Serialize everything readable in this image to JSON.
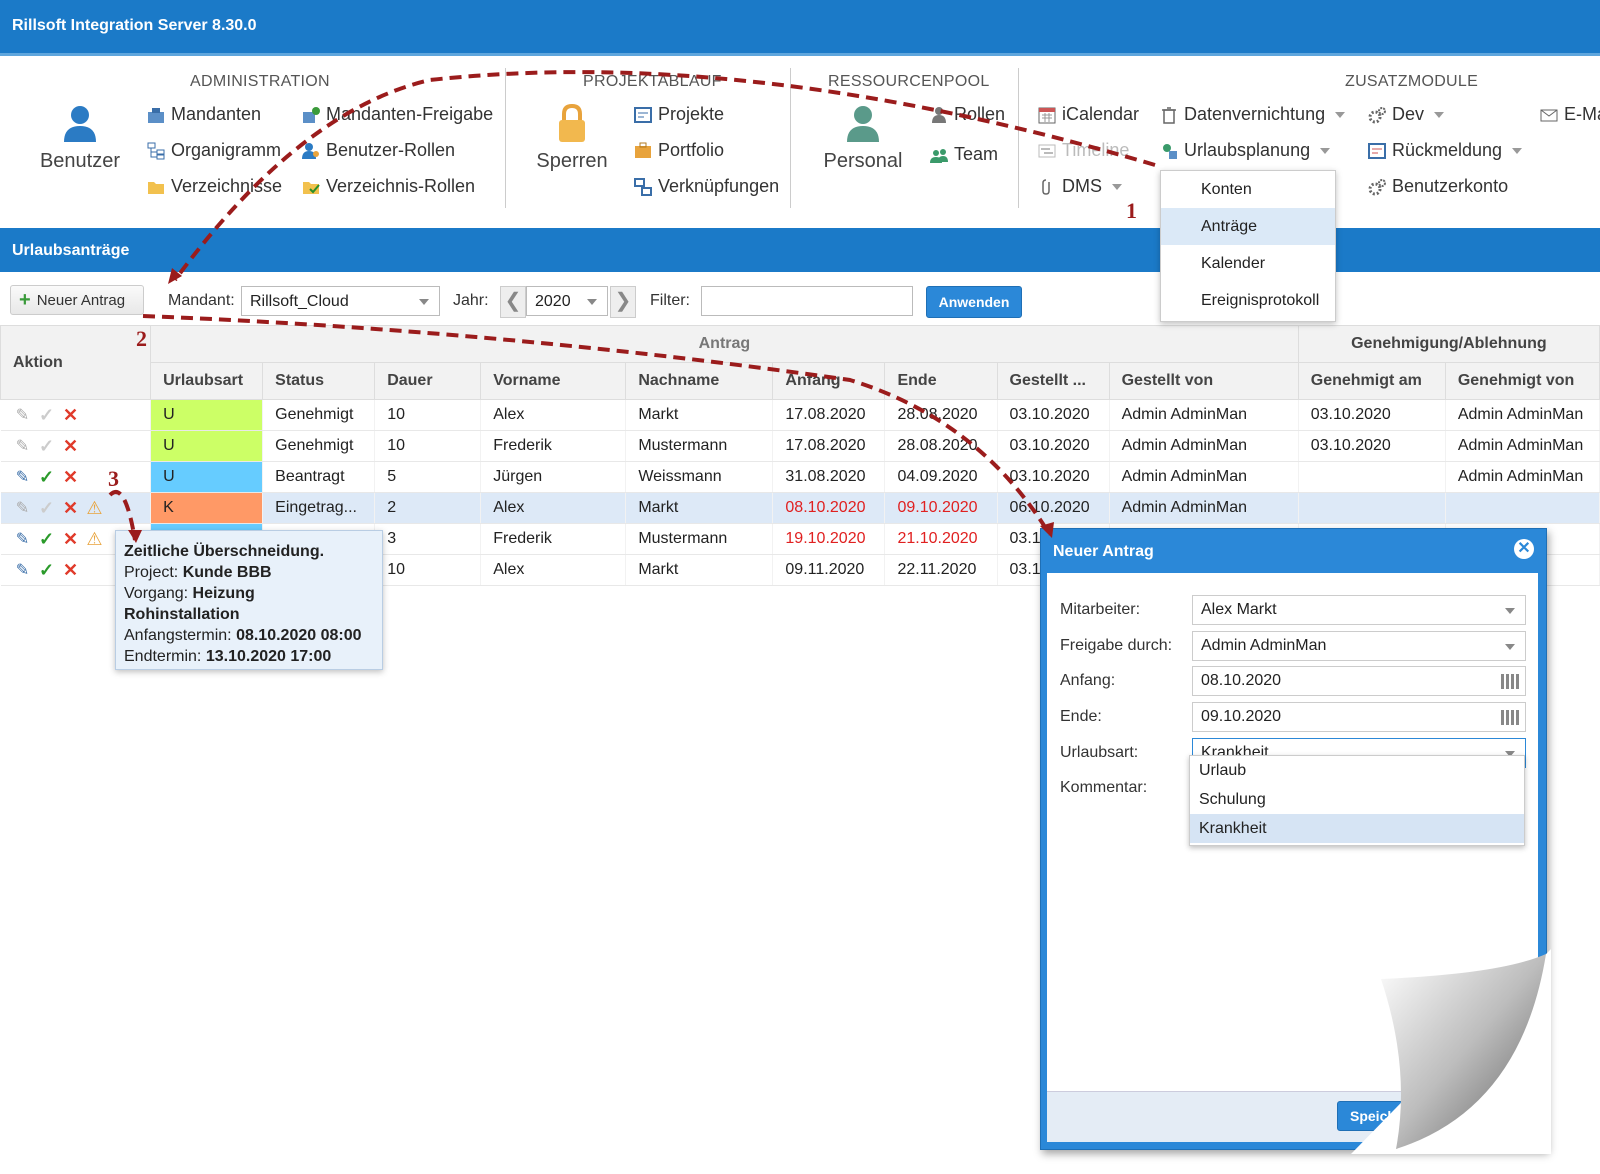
{
  "app": {
    "title": "Rillsoft Integration Server 8.30.0"
  },
  "ribbon": {
    "benutzer": "Benutzer",
    "administration": {
      "title": "ADMINISTRATION",
      "items": [
        "Mandanten",
        "Mandanten-Freigabe",
        "Organigramm",
        "Benutzer-Rollen",
        "Verzeichnisse",
        "Verzeichnis-Rollen"
      ]
    },
    "projektablauf": {
      "title": "PROJEKTABLAUF",
      "sperren": "Sperren",
      "items": [
        "Projekte",
        "Portfolio",
        "Verknüpfungen"
      ]
    },
    "ressourcenpool": {
      "title": "RESSOURCENPOOL",
      "personal": "Personal",
      "items": [
        "Rollen",
        "Team"
      ]
    },
    "zusatzmodule": {
      "title": "ZUSATZMODULE",
      "icalendar": "iCalendar",
      "timeline": "Timeline",
      "dms": "DMS",
      "datenvernichtung": "Datenvernichtung",
      "urlaubsplanung": "Urlaubsplanung",
      "dev": "Dev",
      "rueckmeldung": "Rückmeldung",
      "benutzerkonto": "Benutzerkonto",
      "email": "E-Ma"
    }
  },
  "menu": {
    "items": [
      "Konten",
      "Anträge",
      "Kalender",
      "Ereignisprotokoll"
    ],
    "active": "Anträge"
  },
  "section": {
    "title": "Urlaubsanträge"
  },
  "toolbar": {
    "new_label": "Neuer Antrag",
    "mandant_label": "Mandant:",
    "mandant_value": "Rillsoft_Cloud",
    "jahr_label": "Jahr:",
    "jahr_value": "2020",
    "filter_label": "Filter:",
    "filter_value": "",
    "apply_label": "Anwenden"
  },
  "table": {
    "group_headers": {
      "aktion": "Aktion",
      "antrag": "Antrag",
      "genehmigung": "Genehmigung/Ablehnung"
    },
    "columns": [
      "Urlaubsart",
      "Status",
      "Dauer",
      "Vorname",
      "Nachname",
      "Anfang",
      "Ende",
      "Gestellt ...",
      "Gestellt von",
      "Genehmigt am",
      "Genehmigt von"
    ],
    "rows": [
      {
        "art": "U",
        "art_color": "#ccff66",
        "status": "Genehmigt",
        "dauer": "10",
        "vorname": "Alex",
        "nachname": "Markt",
        "anfang": "17.08.2020",
        "ende": "28.08.2020",
        "gestellt": "03.10.2020",
        "gestellt_von": "Admin AdminMan",
        "genehmigt_am": "03.10.2020",
        "genehmigt_von": "Admin AdminMan"
      },
      {
        "art": "U",
        "art_color": "#ccff66",
        "status": "Genehmigt",
        "dauer": "10",
        "vorname": "Frederik",
        "nachname": "Mustermann",
        "anfang": "17.08.2020",
        "ende": "28.08.2020",
        "gestellt": "03.10.2020",
        "gestellt_von": "Admin AdminMan",
        "genehmigt_am": "03.10.2020",
        "genehmigt_von": "Admin AdminMan"
      },
      {
        "art": "U",
        "art_color": "#66ccff",
        "status": "Beantragt",
        "dauer": "5",
        "vorname": "Jürgen",
        "nachname": "Weissmann",
        "anfang": "31.08.2020",
        "ende": "04.09.2020",
        "gestellt": "03.10.2020",
        "gestellt_von": "Admin AdminMan",
        "genehmigt_am": "",
        "genehmigt_von": "Admin AdminMan"
      },
      {
        "art": "K",
        "art_color": "#ff9966",
        "status": "Eingetrag...",
        "dauer": "2",
        "vorname": "Alex",
        "nachname": "Markt",
        "anfang": "08.10.2020",
        "ende": "09.10.2020",
        "gestellt": "06.10.2020",
        "gestellt_von": "Admin AdminMan",
        "genehmigt_am": "",
        "genehmigt_von": ""
      },
      {
        "art": "",
        "art_color": "#66ccff",
        "status": "",
        "dauer": "3",
        "vorname": "Frederik",
        "nachname": "Mustermann",
        "anfang": "19.10.2020",
        "ende": "21.10.2020",
        "gestellt": "03.1",
        "gestellt_von": "",
        "genehmigt_am": "",
        "genehmigt_von": "inMan"
      },
      {
        "art": "",
        "art_color": "#ffffff",
        "status": "",
        "dauer": "10",
        "vorname": "Alex",
        "nachname": "Markt",
        "anfang": "09.11.2020",
        "ende": "22.11.2020",
        "gestellt": "03.1",
        "gestellt_von": "",
        "genehmigt_am": "",
        "genehmigt_von": "inMan"
      }
    ]
  },
  "tooltip": {
    "title": "Zeitliche Überschneidung.",
    "project_label": "Project:",
    "project_value": "Kunde BBB",
    "vorgang_label": "Vorgang:",
    "vorgang_value": "Heizung Rohinstallation",
    "anfang_label": "Anfangstermin:",
    "anfang_value": "08.10.2020 08:00",
    "end_label": "Endtermin:",
    "end_value": "13.10.2020 17:00"
  },
  "dialog": {
    "title": "Neuer Antrag",
    "fields": {
      "mitarbeiter_label": "Mitarbeiter:",
      "mitarbeiter_value": "Alex Markt",
      "freigabe_label": "Freigabe durch:",
      "freigabe_value": "Admin AdminMan",
      "anfang_label": "Anfang:",
      "anfang_value": "08.10.2020",
      "ende_label": "Ende:",
      "ende_value": "09.10.2020",
      "urlaubsart_label": "Urlaubsart:",
      "urlaubsart_value": "Krankheit",
      "kommentar_label": "Kommentar:"
    },
    "options": [
      "Urlaub",
      "Schulung",
      "Krankheit"
    ],
    "save_label": "Speiche"
  },
  "annotations": [
    "1",
    "2",
    "3"
  ],
  "colors": {
    "accent": "#1b7ac8",
    "overdue": "#e02020",
    "annotation": "#9b1c1c"
  }
}
